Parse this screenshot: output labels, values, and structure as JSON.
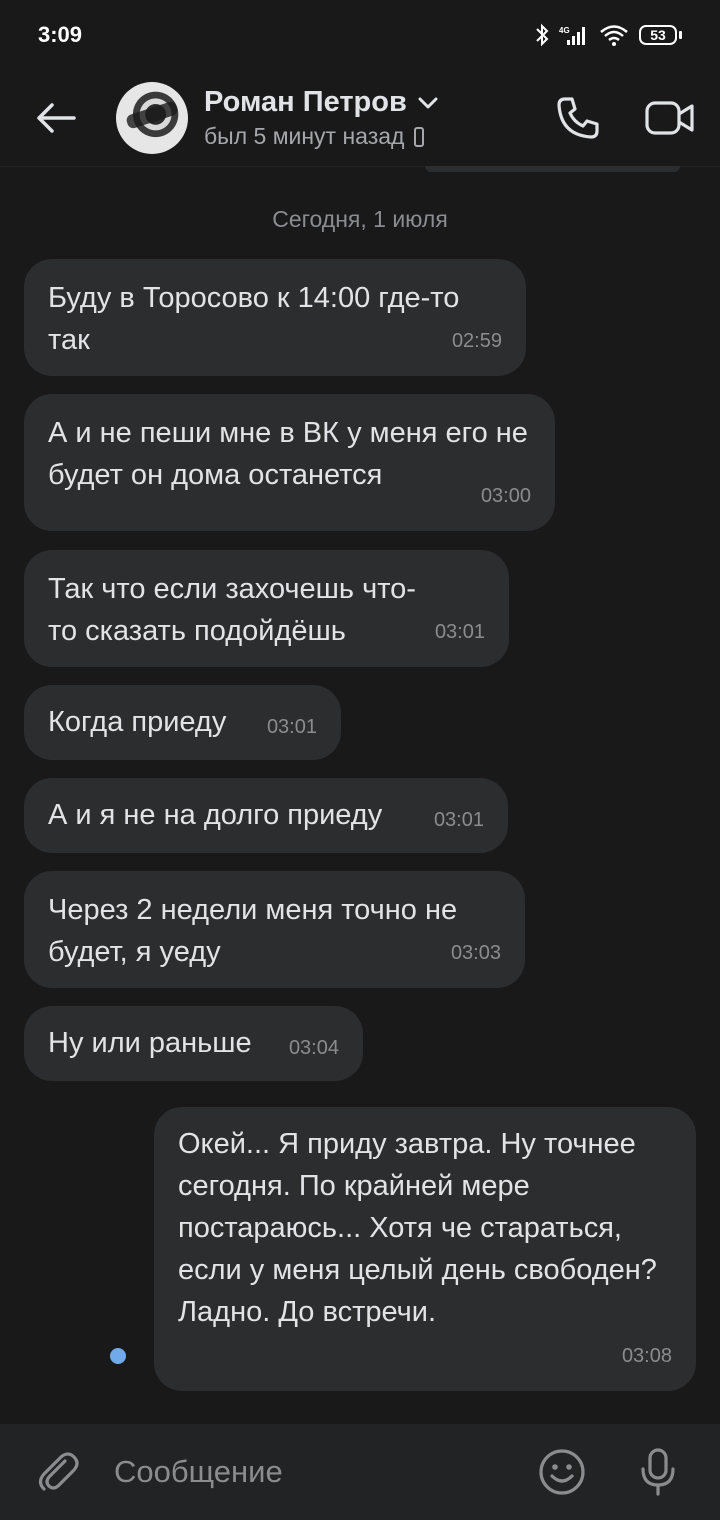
{
  "status_bar": {
    "time": "3:09",
    "battery": "53"
  },
  "header": {
    "contact_name": "Роман Петров",
    "last_seen": "был 5 минут назад"
  },
  "chat": {
    "date_separator": "Сегодня, 1 июля",
    "messages": [
      {
        "text": "Буду в Торосово к 14:00 где-то так",
        "time": "02:59",
        "direction": "in"
      },
      {
        "text": "А и не пеши мне в ВК у меня его не будет он дома останется",
        "time": "03:00",
        "direction": "in"
      },
      {
        "text": "Так что если захочешь что-то сказать подойдёшь",
        "time": "03:01",
        "direction": "in"
      },
      {
        "text": "Когда приеду",
        "time": "03:01",
        "direction": "in"
      },
      {
        "text": "А и я не на долго приеду",
        "time": "03:01",
        "direction": "in"
      },
      {
        "text": "Через 2 недели меня точно не будет, я уеду",
        "time": "03:03",
        "direction": "in"
      },
      {
        "text": "Ну или раньше",
        "time": "03:04",
        "direction": "in"
      },
      {
        "text": "Окей... Я приду завтра. Ну точнее сегодня. По крайней мере постараюсь... Хотя че стараться, если у меня целый день свободен?\nЛадно. До встречи.",
        "time": "03:08",
        "direction": "out",
        "unread": true
      }
    ]
  },
  "composer": {
    "placeholder": "Сообщение"
  },
  "colors": {
    "background": "#19191a",
    "bubble": "#2c2d2f",
    "accent": "#71aaeb"
  }
}
